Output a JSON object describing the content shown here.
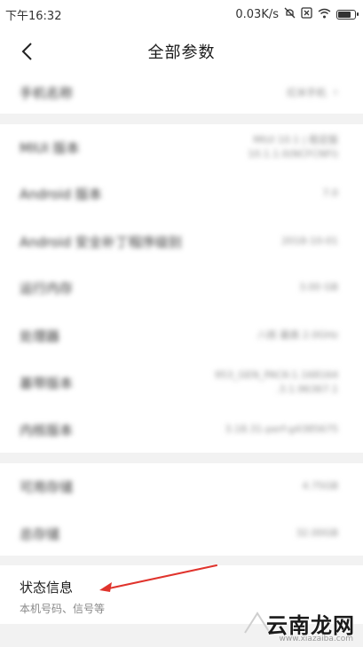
{
  "status_bar": {
    "time": "下午16:32",
    "network_speed": "0.03K/s",
    "icons": [
      "mute-icon",
      "sim-x-icon",
      "wifi-icon",
      "battery-icon"
    ],
    "battery_level": 0.8
  },
  "header": {
    "title": "全部参数",
    "back_icon": "chevron-left-icon"
  },
  "rows": [
    {
      "label": "手机名称",
      "value": "红米手机",
      "chevron": "›"
    },
    {
      "label": "MIUI 版本",
      "value": "MIUI 10.1 | 稳定版\n10.1.1.0(NCFCNFI)"
    },
    {
      "label": "Android 版本",
      "value": "7.0"
    },
    {
      "label": "Android 安全补丁程序级别",
      "value": "2018-10-01"
    },
    {
      "label": "运行内存",
      "value": "3.00 GB"
    },
    {
      "label": "处理器",
      "value": "八核 最高 2.0GHz"
    },
    {
      "label": "基带版本",
      "value": "953_GEN_PACK-1.168164\n.3.1.96367.1"
    },
    {
      "label": "内核版本",
      "value": "3.18.31-perf-g4385675"
    },
    {
      "label": "可用存储",
      "value": "4.75GB"
    },
    {
      "label": "总存储",
      "value": "32.00GB"
    }
  ],
  "status_info": {
    "title": "状态信息",
    "subtitle": "本机号码、信号等"
  },
  "watermark": {
    "text": "云南龙网",
    "url": "www.xiazaiba.com"
  },
  "colors": {
    "arrow": "#e0332c",
    "section_gap": "#f2f2f2"
  }
}
